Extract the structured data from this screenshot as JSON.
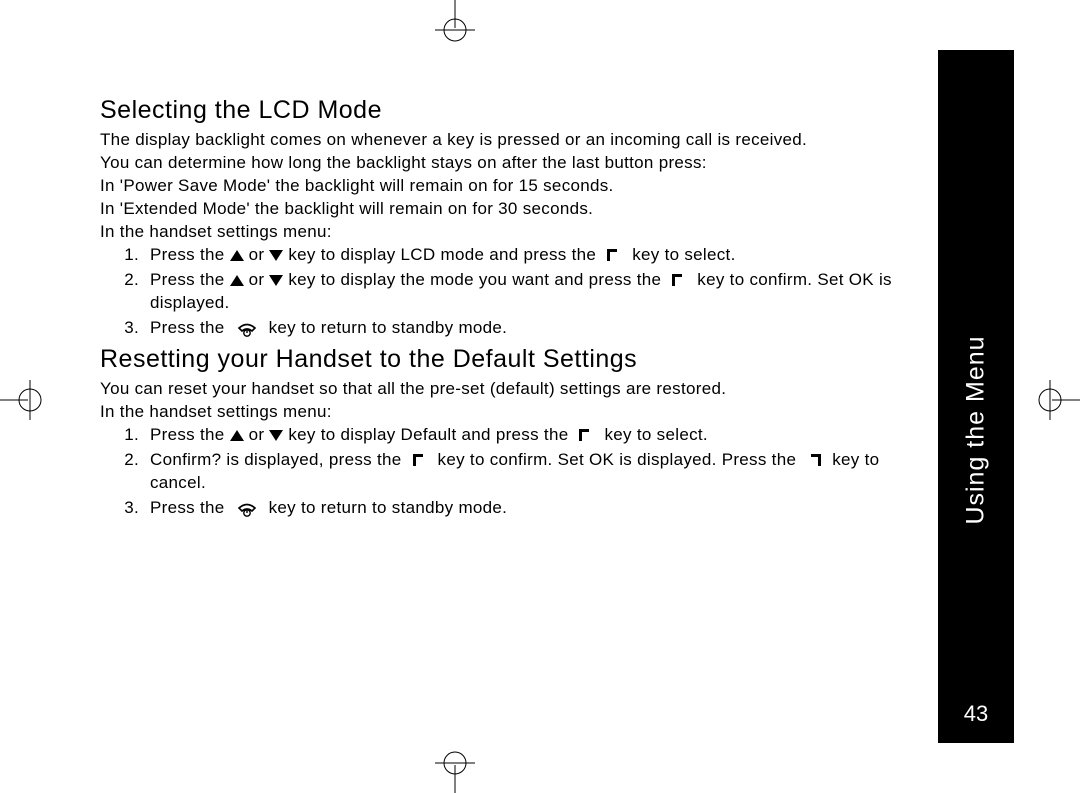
{
  "sidebar": {
    "label": "Using the Menu",
    "page_number": "43"
  },
  "section1": {
    "heading": "Selecting the LCD Mode",
    "p1": "The display backlight comes on whenever a key is pressed or an incoming call is received.",
    "p2": "You can determine how long the backlight stays on after the last button press:",
    "p3": "In 'Power Save Mode' the backlight will remain on for 15 seconds.",
    "p4": "In 'Extended Mode' the backlight will remain on for 30 seconds.",
    "p5": "In the handset settings menu:",
    "li1a": "Press the ",
    "li1b": " or ",
    "li1c": " key to display LCD mode and press the ",
    "li1d": " key to select.",
    "li2a": "Press the ",
    "li2b": " or ",
    "li2c": " key to display the mode you want and press the ",
    "li2d": " key to confirm. Set OK is displayed.",
    "li3a": "Press the ",
    "li3b": " key to return to standby mode."
  },
  "section2": {
    "heading": "Resetting your Handset to the Default Settings",
    "p1": "You can reset your handset so that all the pre-set (default) settings are restored.",
    "p2": "In the handset settings menu:",
    "li1a": "Press the ",
    "li1b": " or ",
    "li1c": " key to display Default and press the ",
    "li1d": " key to select.",
    "li2a": "Confirm? is displayed, press the ",
    "li2b": " key to confirm. Set OK is displayed. Press the ",
    "li2c": " key to cancel.",
    "li3a": "Press the ",
    "li3b": " key to return to standby mode."
  }
}
